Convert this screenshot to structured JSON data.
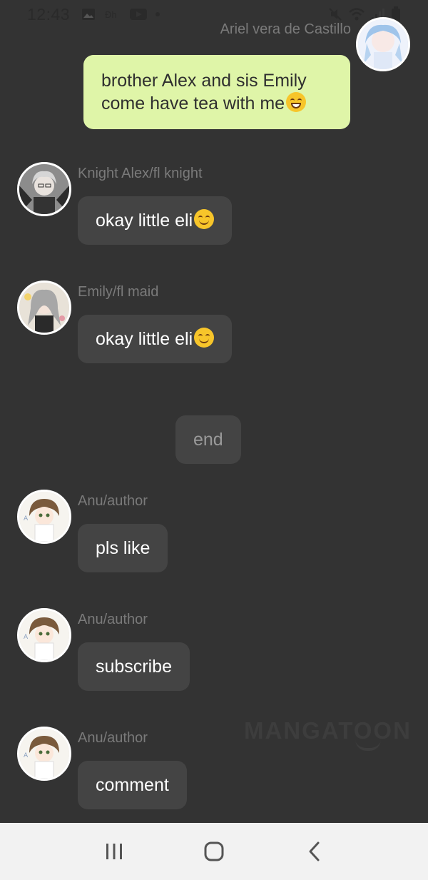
{
  "status_bar": {
    "time": "12:43",
    "icons_left": [
      "image-icon",
      "dh-icon",
      "youtube-icon",
      "dot-icon"
    ],
    "icons_right": [
      "mute-icon",
      "wifi-icon",
      "signal-icon",
      "battery-icon"
    ]
  },
  "messages": [
    {
      "sender": "Ariel vera de Castillo",
      "text": "brother Alex and sis Emily come have tea with me",
      "emoji": "grin-emoji-icon",
      "mine": true
    },
    {
      "sender": "Knight Alex/fl knight",
      "text": "okay little eli",
      "emoji": "smile-emoji-icon"
    },
    {
      "sender": "Emily/fl maid",
      "text": "okay little eli",
      "emoji": "smile-emoji-icon"
    },
    {
      "system": true,
      "text": "end"
    },
    {
      "sender": "Anu/author",
      "text": "pls like"
    },
    {
      "sender": "Anu/author",
      "text": "subscribe"
    },
    {
      "sender": "Anu/author",
      "text": "comment"
    }
  ],
  "watermark": "MANGATOON",
  "navigation": {
    "recents_icon": "recents-icon",
    "home_icon": "home-icon",
    "back_icon": "back-icon"
  },
  "colors": {
    "background": "#333333",
    "bubble": "#444444",
    "my_bubble": "#dff5a8",
    "sender_text": "#7a7a7a"
  }
}
